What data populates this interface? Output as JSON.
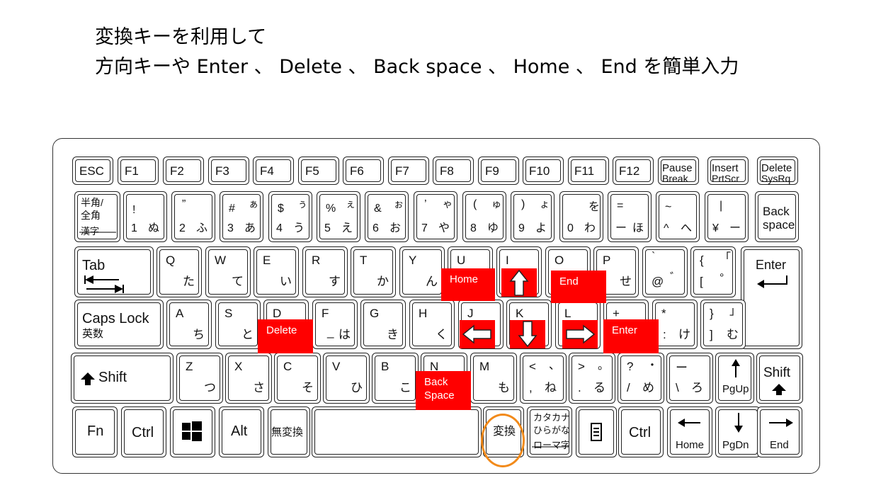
{
  "title": {
    "line1": "変換キーを利用して",
    "line2": "方向キーや Enter 、 Delete 、 Back space 、 Home 、 End を簡単入力"
  },
  "colors": {
    "overlay": "#ff0000",
    "highlight_ring": "#f28a1a"
  },
  "overlays": {
    "home": "Home",
    "end": "End",
    "delete": "Delete",
    "enter": "Enter",
    "backspace": "Back\nSpace"
  },
  "overlay_icons": [
    "arrow-up-icon",
    "arrow-left-icon",
    "arrow-down-icon",
    "arrow-right-icon"
  ],
  "highlighted_key": "変換",
  "keys": {
    "esc": "ESC",
    "f1": "F1",
    "f2": "F2",
    "f3": "F3",
    "f4": "F4",
    "f5": "F5",
    "f6": "F6",
    "f7": "F7",
    "f8": "F8",
    "f9": "F9",
    "f10": "F10",
    "f11": "F11",
    "f12": "F12",
    "pause_1": "Pause",
    "pause_2": "Break",
    "insert_1": "Insert",
    "insert_2": "PrtScr",
    "delete_1": "Delete",
    "delete_2": "SysRq",
    "hankaku_1": "半角/",
    "hankaku_2": "全角",
    "hankaku_3": "漢字",
    "k1_s": "!",
    "k1_n": "1",
    "k1_k": "ぬ",
    "k2_s": "”",
    "k2_n": "2",
    "k2_k": "ふ",
    "k3_s": "#",
    "k3_k2": "ぁ",
    "k3_n": "3",
    "k3_k": "あ",
    "k4_s": "$",
    "k4_k2": "ぅ",
    "k4_n": "4",
    "k4_k": "う",
    "k5_s": "%",
    "k5_k2": "ぇ",
    "k5_n": "5",
    "k5_k": "え",
    "k6_s": "&",
    "k6_k2": "ぉ",
    "k6_n": "6",
    "k6_k": "お",
    "k7_s": "’",
    "k7_k2": "ゃ",
    "k7_n": "7",
    "k7_k": "や",
    "k8_s": "(",
    "k8_k2": "ゅ",
    "k8_n": "8",
    "k8_k": "ゆ",
    "k9_s": ")",
    "k9_k2": "ょ",
    "k9_n": "9",
    "k9_k": "よ",
    "k0_k2": "を",
    "k0_n": "0",
    "k0_k": "わ",
    "kminus_s": "=",
    "kminus_n": "ー",
    "kminus_k": "ほ",
    "kcaret_s": "~",
    "kcaret_n": "^",
    "kcaret_k": "へ",
    "kyen_s": "|",
    "kyen_n": "¥",
    "kyen_k": "ー",
    "backspace_1": "Back",
    "backspace_2": "space",
    "tab": "Tab",
    "q": "Q",
    "q_k": "た",
    "w": "W",
    "w_k": "て",
    "e": "E",
    "e_k": "い",
    "r": "R",
    "r_k": "す",
    "t": "T",
    "t_k": "か",
    "y": "Y",
    "y_k": "ん",
    "u": "U",
    "i": "I",
    "o": "O",
    "p": "P",
    "p_k": "せ",
    "at_s": "`",
    "at_n": "@",
    "at_k": "゛",
    "lb_s": "{",
    "lb_k2": "「",
    "lb_n": "[",
    "lb_k": "°",
    "enter": "Enter",
    "caps_1": "Caps Lock",
    "caps_2": "英数",
    "a": "A",
    "a_k": "ち",
    "s": "S",
    "s_k": "と",
    "d": "D",
    "f": "F",
    "f_k": "は",
    "f_u": "_",
    "g": "G",
    "g_k": "き",
    "h": "H",
    "h_k": "く",
    "j": "J",
    "k": "K",
    "l": "L",
    "semi_s": "+",
    "colon_s": "*",
    "colon_n": ":",
    "colon_k": "け",
    "rb_s": "}",
    "rb_k2": "」",
    "rb_n": "]",
    "rb_k": "む",
    "shift": "Shift",
    "z": "Z",
    "z_k": "つ",
    "x": "X",
    "x_k": "さ",
    "c": "C",
    "c_k": "そ",
    "v": "V",
    "v_k": "ひ",
    "b": "B",
    "b_k": "こ",
    "n": "N",
    "m": "M",
    "m_k": "も",
    "comma_s": "<",
    "comma_k2": "、",
    "comma_n": ",",
    "comma_k": "ね",
    "period_s": ">",
    "period_k2": "。",
    "period_n": ".",
    "period_k": "る",
    "slash_s": "?",
    "slash_k2": "・",
    "slash_n": "/",
    "slash_k": "め",
    "bs_s": "ー",
    "bs_n": "\\",
    "bs_k": "ろ",
    "pgup": "PgUp",
    "rshift": "Shift",
    "fn": "Fn",
    "ctrl": "Ctrl",
    "alt": "Alt",
    "muhenkan": "無変換",
    "henkan": "変換",
    "kana_1": "カタカナ",
    "kana_2": "ひらがな",
    "kana_3": "ローマ字",
    "rctrl": "Ctrl",
    "home": "Home",
    "pgdn": "PgDn",
    "end": "End"
  }
}
